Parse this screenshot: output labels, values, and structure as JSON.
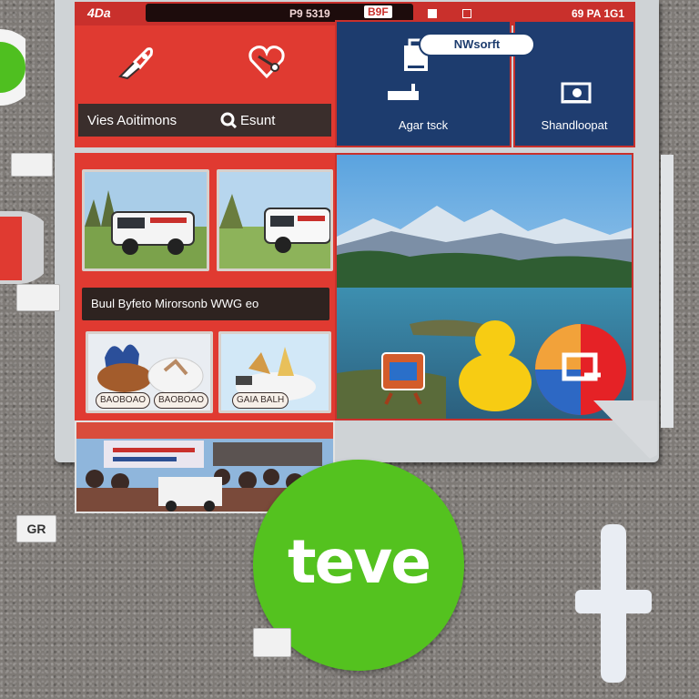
{
  "status_bar": {
    "brand": "4Da",
    "left": "P9 5319",
    "mid": "B9F",
    "right": "69 PA 1G1"
  },
  "top_left": {
    "label_left": "Vies Aoitimons",
    "label_right": "Esunt"
  },
  "top_right": {
    "pill": "NWsorft",
    "tile_1_label": "Agar tsck",
    "tile_2_label": "Shandloopat"
  },
  "middle": {
    "promo": "Buul Byfeto Mirorsonb WWG eo",
    "chip_1": "BAOBOAO",
    "chip_2": "BAOBOAO",
    "chip_3": "GAIA BALH"
  },
  "green_button": {
    "label": "teve"
  },
  "stickers": {
    "left_sticker": "GR"
  },
  "colors": {
    "accent_red": "#e03a31",
    "navy": "#1d3c6e",
    "green": "#54c21f",
    "yellow": "#f7cc13"
  }
}
